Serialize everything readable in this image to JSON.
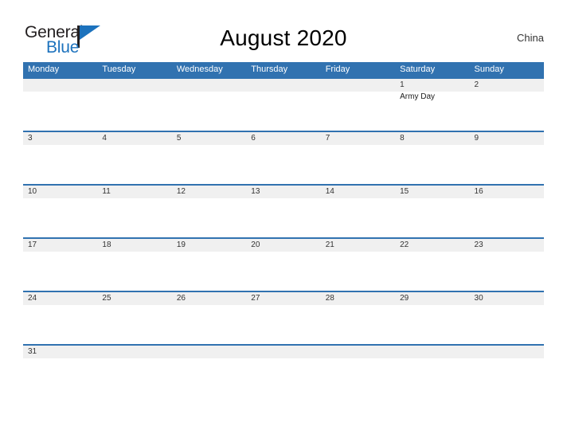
{
  "brand": {
    "word_one": "General",
    "word_two": "Blue",
    "flag_icon": "flag-triangle-icon",
    "accent_color": "#1c72bd"
  },
  "header": {
    "title": "August 2020",
    "country": "China"
  },
  "calendar": {
    "header_color": "#3172b0",
    "band_color": "#f0f0f0",
    "separator_color": "#3172b0",
    "day_names": [
      "Monday",
      "Tuesday",
      "Wednesday",
      "Thursday",
      "Friday",
      "Saturday",
      "Sunday"
    ],
    "weeks": [
      [
        {
          "num": "",
          "event": ""
        },
        {
          "num": "",
          "event": ""
        },
        {
          "num": "",
          "event": ""
        },
        {
          "num": "",
          "event": ""
        },
        {
          "num": "",
          "event": ""
        },
        {
          "num": "1",
          "event": "Army Day"
        },
        {
          "num": "2",
          "event": ""
        }
      ],
      [
        {
          "num": "3",
          "event": ""
        },
        {
          "num": "4",
          "event": ""
        },
        {
          "num": "5",
          "event": ""
        },
        {
          "num": "6",
          "event": ""
        },
        {
          "num": "7",
          "event": ""
        },
        {
          "num": "8",
          "event": ""
        },
        {
          "num": "9",
          "event": ""
        }
      ],
      [
        {
          "num": "10",
          "event": ""
        },
        {
          "num": "11",
          "event": ""
        },
        {
          "num": "12",
          "event": ""
        },
        {
          "num": "13",
          "event": ""
        },
        {
          "num": "14",
          "event": ""
        },
        {
          "num": "15",
          "event": ""
        },
        {
          "num": "16",
          "event": ""
        }
      ],
      [
        {
          "num": "17",
          "event": ""
        },
        {
          "num": "18",
          "event": ""
        },
        {
          "num": "19",
          "event": ""
        },
        {
          "num": "20",
          "event": ""
        },
        {
          "num": "21",
          "event": ""
        },
        {
          "num": "22",
          "event": ""
        },
        {
          "num": "23",
          "event": ""
        }
      ],
      [
        {
          "num": "24",
          "event": ""
        },
        {
          "num": "25",
          "event": ""
        },
        {
          "num": "26",
          "event": ""
        },
        {
          "num": "27",
          "event": ""
        },
        {
          "num": "28",
          "event": ""
        },
        {
          "num": "29",
          "event": ""
        },
        {
          "num": "30",
          "event": ""
        }
      ],
      [
        {
          "num": "31",
          "event": ""
        },
        {
          "num": "",
          "event": ""
        },
        {
          "num": "",
          "event": ""
        },
        {
          "num": "",
          "event": ""
        },
        {
          "num": "",
          "event": ""
        },
        {
          "num": "",
          "event": ""
        },
        {
          "num": "",
          "event": ""
        }
      ]
    ]
  }
}
